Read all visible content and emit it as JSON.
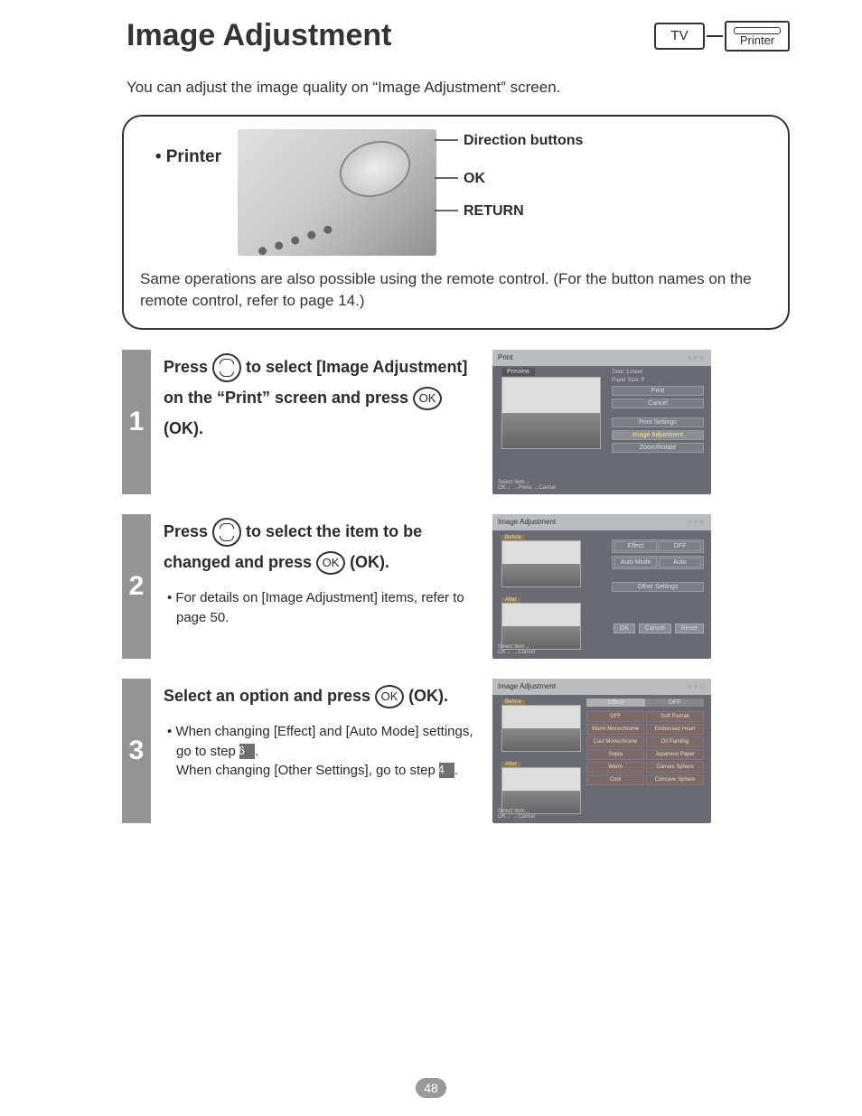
{
  "page_title": "Image Adjustment",
  "diagram": {
    "tv": "TV",
    "printer": "Printer"
  },
  "intro": "You can adjust the image quality on “Image Adjustment” screen.",
  "printer_panel": {
    "label": "• Printer",
    "callouts": {
      "direction": "Direction buttons",
      "ok": "OK",
      "return": "RETURN"
    },
    "note": "Same operations are also possible using the remote control. (For the button names on the remote control, refer to page 14.)"
  },
  "steps": [
    {
      "num": "1",
      "pre": "Press ",
      "mid1": " to select [Image Adjustment] on the “Print” screen and press ",
      "post": " (OK).",
      "ok_label": "OK",
      "screenshot": {
        "title": "Print",
        "preview_label": "Preview",
        "info1": "Total:        1sheet",
        "info2": "Paper Size:        P",
        "items": [
          "Print",
          "Cancel",
          "Print Settings",
          "Image Adjustment",
          "Zoom/Rotate"
        ],
        "highlighted_index": 3,
        "footer1": "Select item→",
        "footer2": "OK→         →Press\n            →Cancel"
      }
    },
    {
      "num": "2",
      "pre": "Press ",
      "mid1": " to select the item to be changed and press ",
      "post": " (OK).",
      "ok_label": "OK",
      "sub": "• For details on [Image Adjustment] items, refer to page 50.",
      "screenshot": {
        "title": "Image Adjustment",
        "before": "Before",
        "after": "After",
        "rows": [
          {
            "label": "Effect",
            "value": "OFF"
          },
          {
            "label": "Auto Mode",
            "value": "Auto"
          }
        ],
        "other": "Other Settings",
        "buttons": [
          "OK",
          "Cancel",
          "Reset"
        ],
        "footer1": "Select item→",
        "footer2": "OK→         →Cancel"
      }
    },
    {
      "num": "3",
      "pre": "Select an option and press ",
      "post": " (OK).",
      "ok_label": "OK",
      "sub1a": "• When changing [Effect] and [Auto Mode] settings, go to step ",
      "sub1_num": "6",
      "sub1b": ".",
      "sub2a": "When changing [Other Settings], go to step ",
      "sub2_num": "4",
      "sub2b": ".",
      "screenshot": {
        "title": "Image Adjustment",
        "before": "Before",
        "after": "After",
        "tabs": [
          "Effect",
          "OFF"
        ],
        "options": [
          "OFF",
          "Soft Portrait",
          "Warm Monochrome",
          "Embossed Heart",
          "Cool Monochrome",
          "Oil Painting",
          "Sepia",
          "Japanese Paper",
          "Warm",
          "Convex Sphere",
          "Cool",
          "Concave Sphere"
        ],
        "footer1": "Select item→",
        "footer2": "OK→         →Cancel"
      }
    }
  ],
  "page_number": "48"
}
